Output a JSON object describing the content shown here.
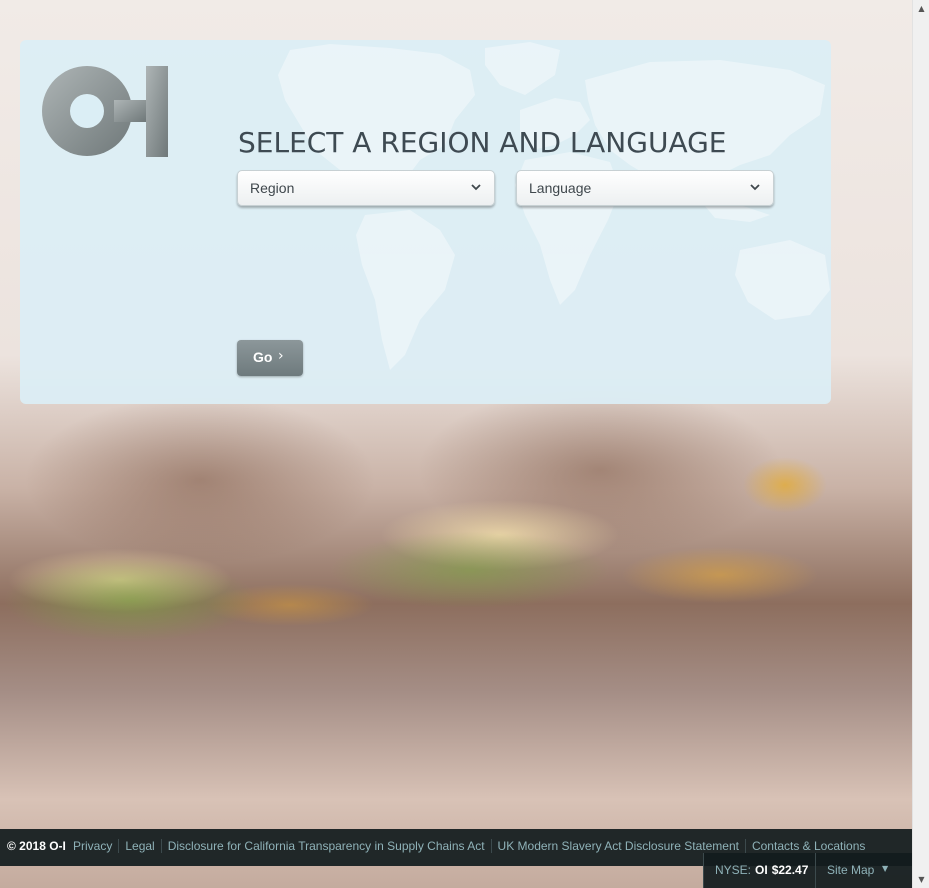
{
  "brand": {
    "logo_text": "O-I",
    "logo_color": "#8d9596"
  },
  "selector": {
    "title": "SELECT A REGION AND LANGUAGE",
    "region_label": "Region",
    "language_label": "Language",
    "go_label": "Go",
    "go_arrow": "›"
  },
  "footer": {
    "copyright": "© 2018 O-I",
    "links": [
      "Privacy",
      "Legal",
      "Disclosure for California Transparency in Supply Chains Act",
      "UK Modern Slavery Act Disclosure Statement",
      "Contacts & Locations"
    ]
  },
  "ticker": {
    "exchange": "NYSE:",
    "symbol": "OI",
    "price": "$22.47"
  },
  "sitemap": {
    "label": "Site Map",
    "caret": "▼"
  },
  "scrollbar": {
    "up_arrow": "▲",
    "down_arrow": "▼"
  },
  "colors": {
    "panel_bg": "#dbeef5",
    "title": "#3e4a52",
    "footer_bg": "#121c1e",
    "footer_link": "#8fb2b8",
    "go_button": "#7d888b"
  },
  "icons": {
    "region_chevron": "chevron-down-icon",
    "language_chevron": "chevron-down-icon",
    "map": "world-map"
  }
}
